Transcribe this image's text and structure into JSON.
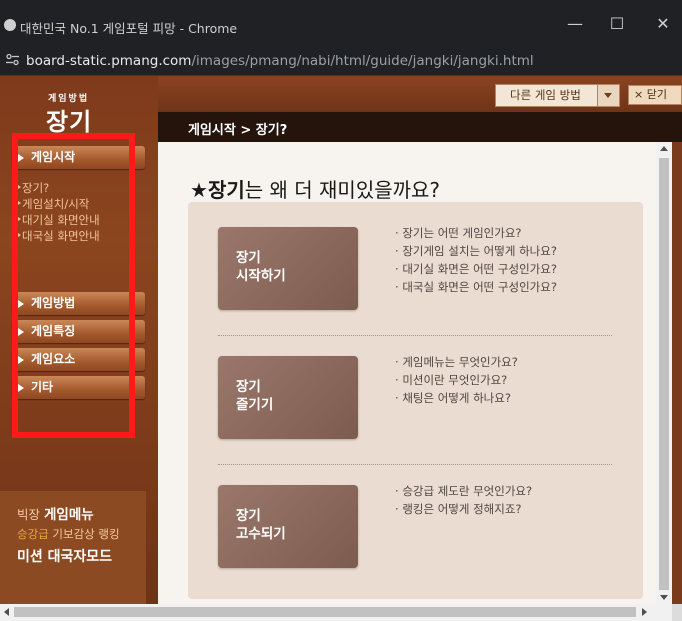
{
  "window": {
    "title": "대한민국 No.1 게임포털 피망 - Chrome",
    "url_domain": "board-static.pmang.com",
    "url_path": "/images/pmang/nabi/html/guide/jangki/jangki.html"
  },
  "brand": {
    "small": "게임방법",
    "big": "장기"
  },
  "top_controls": {
    "select_label": "다른 게임 방법",
    "close_label": "× 닫기"
  },
  "breadcrumb": "게임시작 > 장기?",
  "sidebar": {
    "menu": [
      {
        "label": "게임시작"
      },
      {
        "label": "게임방법"
      },
      {
        "label": "게임특징"
      },
      {
        "label": "게임요소"
      },
      {
        "label": "기타"
      }
    ],
    "subitems": [
      "장기?",
      "게임설치/시작",
      "대기실 화면안내",
      "대국실 화면안내"
    ]
  },
  "promo": {
    "line1_a": "빅장 ",
    "line1_b": "게임메뉴",
    "line2_a": "승강급 ",
    "line2_b": "기보감상 랭킹",
    "line3": "미션 대국자모드"
  },
  "main": {
    "heading_star": "★",
    "heading_bold": "장기",
    "heading_rest": "는 왜 더 재미있을까요?",
    "sections": [
      {
        "line1": "장기",
        "line2": "시작하기",
        "questions": [
          "장기는 어떤 게임인가요?",
          "장기게임 설치는 어떻게 하나요?",
          "대기실 화면은 어떤 구성인가요?",
          "대국실 화면은 어떤 구성인가요?"
        ]
      },
      {
        "line1": "장기",
        "line2": "즐기기",
        "questions": [
          "게임메뉴는 무엇인가요?",
          "미션이란 무엇인가요?",
          "채팅은 어떻게 하나요?"
        ]
      },
      {
        "line1": "장기",
        "line2": "고수되기",
        "questions": [
          "승강급 제도란 무엇인가요?",
          "랭킹은 어떻게 정해지죠?"
        ]
      }
    ]
  },
  "colors": {
    "brand_brown": "#7a3a1c",
    "crumb_bg": "#24140c",
    "highlight_box": "#ff1a1a"
  }
}
